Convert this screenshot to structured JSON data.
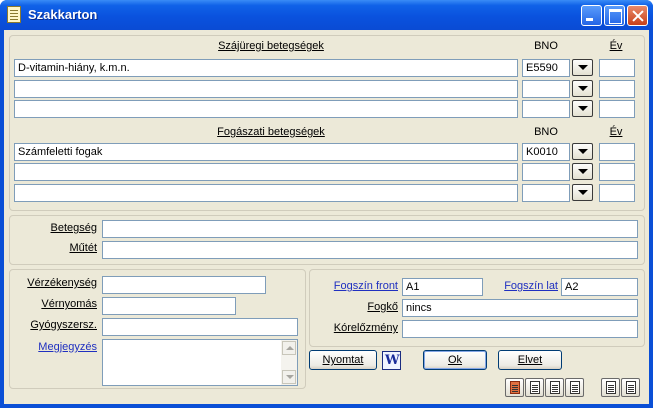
{
  "window": {
    "title": "Szakkarton"
  },
  "szaj": {
    "header": "Szájüregi betegségek",
    "bno_label": "BNO",
    "ev_label": "Év",
    "rows": [
      {
        "name": "D-vitamin-hiány, k.m.n.",
        "bno": "E5590",
        "ev": ""
      },
      {
        "name": "",
        "bno": "",
        "ev": ""
      },
      {
        "name": "",
        "bno": "",
        "ev": ""
      }
    ]
  },
  "fog": {
    "header": "Fogászati betegségek",
    "bno_label": "BNO",
    "ev_label": "Év",
    "rows": [
      {
        "name": "Számfeletti fogak",
        "bno": "K0010",
        "ev": ""
      },
      {
        "name": "",
        "bno": "",
        "ev": ""
      },
      {
        "name": "",
        "bno": "",
        "ev": ""
      }
    ]
  },
  "mid": {
    "betegseg_label": "Betegség",
    "betegseg_value": "",
    "mutet_label": "Műtét",
    "mutet_value": ""
  },
  "left": {
    "verzekenyseg_label": "Vérzékenység",
    "verzekenyseg_value": "",
    "vernyomas_label": "Vérnyomás",
    "vernyomas_value": "",
    "gyogyszersz_label": "Gyógyszersz.",
    "gyogyszersz_value": "",
    "megjegyzes_label": "Megjegyzés",
    "megjegyzes_value": ""
  },
  "right": {
    "fogszin_front_label": "Fogszín front",
    "fogszin_front_value": "A1",
    "fogszin_lat_label": "Fogszín lat",
    "fogszin_lat_value": "A2",
    "fogko_label": "Fogkő",
    "fogko_value": "nincs",
    "korelozmeny_label": "Kórelőzmény",
    "korelozmeny_value": ""
  },
  "buttons": {
    "nyomtat": "Nyomtat",
    "ok": "Ok",
    "elvet": "Elvet"
  },
  "colors": {
    "titlebar": "#0a52de",
    "face": "#ece9d8",
    "link_label": "#2030c0"
  }
}
